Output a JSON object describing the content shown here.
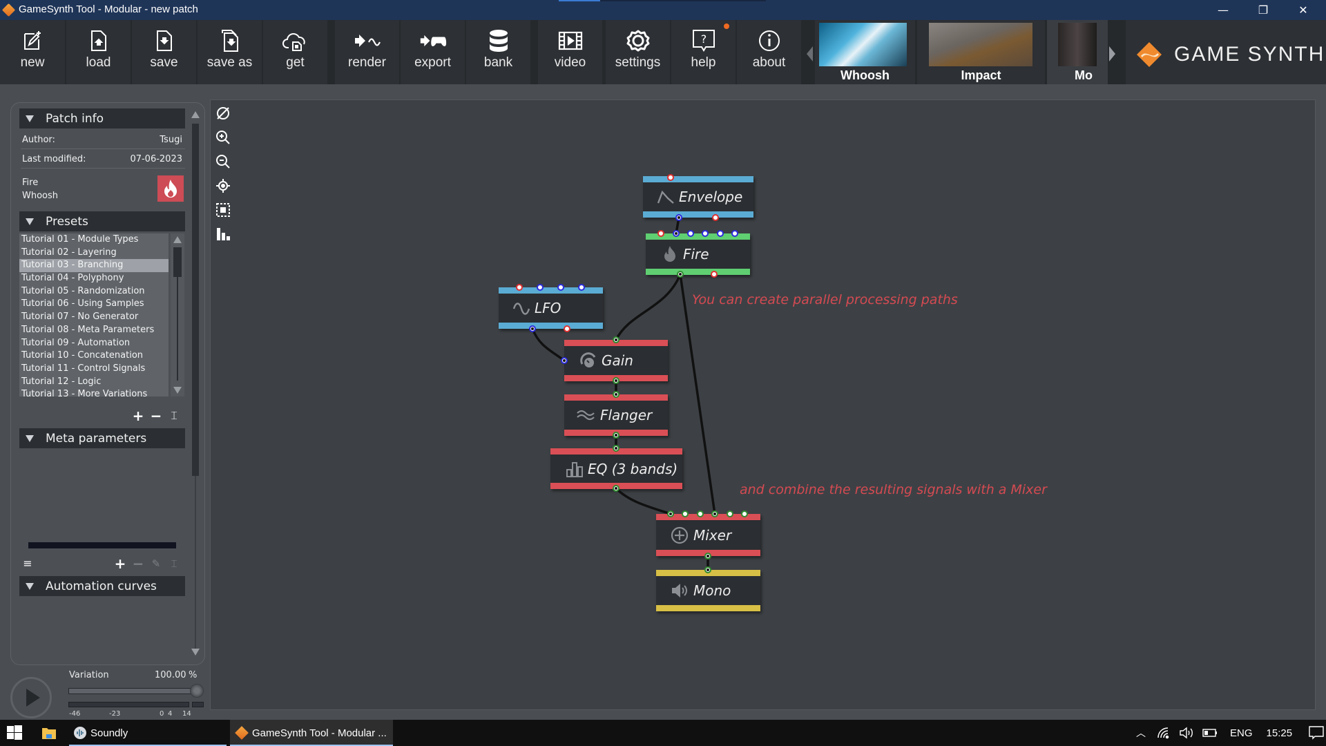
{
  "window": {
    "title": "GameSynth Tool - Modular - new patch",
    "controls": {
      "minimize": "—",
      "restore": "❐",
      "close": "✕"
    }
  },
  "toolbar": {
    "buttons": [
      {
        "id": "new",
        "label": "new",
        "icon": "new-document-icon"
      },
      {
        "id": "load",
        "label": "load",
        "icon": "load-file-icon"
      },
      {
        "id": "save",
        "label": "save",
        "icon": "save-file-icon"
      },
      {
        "id": "save-as",
        "label": "save as",
        "icon": "save-as-icon"
      },
      {
        "id": "get",
        "label": "get",
        "icon": "cloud-download-icon"
      },
      {
        "id": "render",
        "label": "render",
        "icon": "render-icon"
      },
      {
        "id": "export",
        "label": "export",
        "icon": "gamepad-icon"
      },
      {
        "id": "bank",
        "label": "bank",
        "icon": "database-icon"
      },
      {
        "id": "video",
        "label": "video",
        "icon": "film-icon"
      },
      {
        "id": "settings",
        "label": "settings",
        "icon": "gear-icon"
      },
      {
        "id": "help",
        "label": "help",
        "icon": "help-icon",
        "notification": true
      },
      {
        "id": "about",
        "label": "about",
        "icon": "info-icon"
      }
    ],
    "models": [
      {
        "label": "Whoosh"
      },
      {
        "label": "Impact"
      },
      {
        "label": "Mo"
      }
    ],
    "brand": "GAME SYNTH",
    "notification_color": "#f06a22"
  },
  "patch_info": {
    "header": "Patch info",
    "author_label": "Author:",
    "author": "Tsugi",
    "modified_label": "Last modified:",
    "modified": "07-06-2023",
    "tags": [
      "Fire",
      "Whoosh"
    ],
    "category_icon": "fire-icon",
    "category_color": "#cd4c55"
  },
  "presets": {
    "header": "Presets",
    "items": [
      "Tutorial 01 - Module Types",
      "Tutorial 02 - Layering",
      "Tutorial 03 - Branching",
      "Tutorial 04 - Polyphony",
      "Tutorial 05 - Randomization",
      "Tutorial 06 - Using Samples",
      "Tutorial 07 - No Generator",
      "Tutorial 08 - Meta Parameters",
      "Tutorial 09 - Automation",
      "Tutorial 10 - Concatenation",
      "Tutorial 11 - Control Signals",
      "Tutorial 12 - Logic",
      "Tutorial 13 - More Variations"
    ],
    "selected_index": 2,
    "actions": {
      "add": "+",
      "remove": "−",
      "rename": "⌶"
    }
  },
  "meta_parameters": {
    "header": "Meta parameters",
    "actions": {
      "menu": "≡",
      "add": "+",
      "remove": "−",
      "edit": "✎",
      "rename": "⌶"
    }
  },
  "automation_curves": {
    "header": "Automation curves"
  },
  "transport": {
    "variation_label": "Variation",
    "variation_value": "100.00",
    "variation_unit": "%",
    "variation_percent": 100,
    "meter_ticks": [
      "-46",
      "-23",
      "0",
      "4",
      "14"
    ]
  },
  "canvas_tools": [
    "clear-icon",
    "zoom-in-icon",
    "zoom-out-icon",
    "center-view-icon",
    "select-all-icon",
    "layout-icon"
  ],
  "graph": {
    "colors": {
      "control": "#5bacd4",
      "generator": "#5fcf72",
      "effect": "#d94f55",
      "output": "#d8bf45",
      "annotation": "#d54a52"
    },
    "nodes": [
      {
        "id": "envelope",
        "label": "Envelope",
        "type": "control",
        "icon": "envelope-icon"
      },
      {
        "id": "fire",
        "label": "Fire",
        "type": "generator",
        "icon": "flame-icon"
      },
      {
        "id": "lfo",
        "label": "LFO",
        "type": "control",
        "icon": "sine-wave-icon"
      },
      {
        "id": "gain",
        "label": "Gain",
        "type": "effect",
        "icon": "gain-knob-icon"
      },
      {
        "id": "flanger",
        "label": "Flanger",
        "type": "effect",
        "icon": "flanger-wave-icon"
      },
      {
        "id": "eq",
        "label": "EQ (3 bands)",
        "type": "effect",
        "icon": "eq-bars-icon"
      },
      {
        "id": "mixer",
        "label": "Mixer",
        "type": "effect",
        "icon": "plus-circle-icon"
      },
      {
        "id": "mono",
        "label": "Mono",
        "type": "output",
        "icon": "speaker-icon"
      }
    ],
    "connections": [
      {
        "from": "envelope",
        "to": "fire"
      },
      {
        "from": "fire",
        "to": "gain"
      },
      {
        "from": "fire",
        "to": "mixer"
      },
      {
        "from": "lfo",
        "to": "gain"
      },
      {
        "from": "gain",
        "to": "flanger"
      },
      {
        "from": "flanger",
        "to": "eq"
      },
      {
        "from": "eq",
        "to": "mixer"
      },
      {
        "from": "mixer",
        "to": "mono"
      }
    ],
    "annotations": [
      "You can create parallel processing paths",
      "and combine the resulting signals with a Mixer"
    ]
  },
  "taskbar": {
    "apps": [
      {
        "label": "Soundly",
        "icon": "soundly-icon"
      },
      {
        "label": "GameSynth Tool - Modular ...",
        "icon": "gamesynth-icon",
        "active": true
      }
    ],
    "tray": {
      "language": "ENG",
      "time": "15:25"
    }
  }
}
